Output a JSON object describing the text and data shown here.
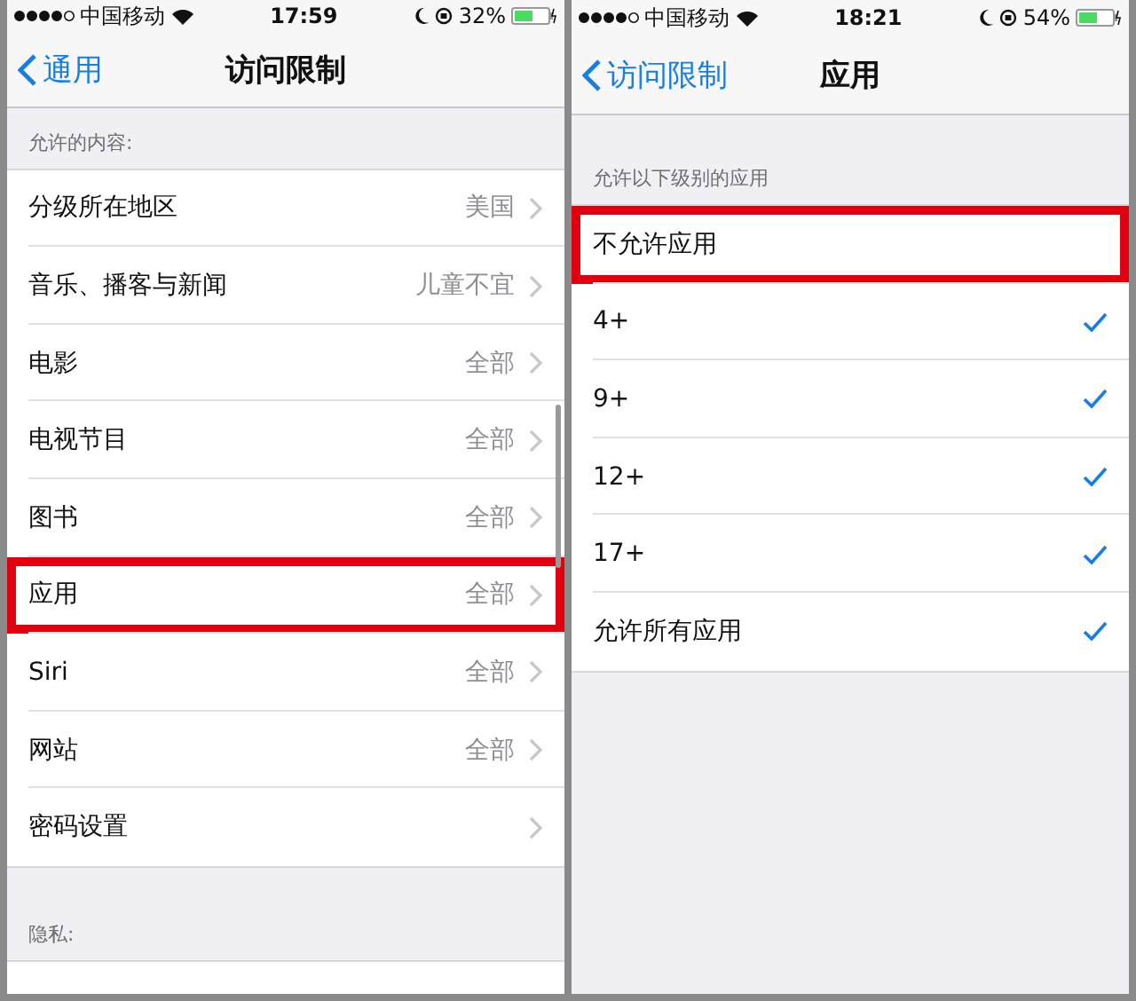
{
  "screens": [
    {
      "status_bar": {
        "carrier": "中国移动",
        "time": "17:59",
        "battery": "32%"
      },
      "nav": {
        "back": "通用",
        "title": "访问限制"
      },
      "sections": [
        {
          "header": "允许的内容:",
          "rows": [
            {
              "kind": "disclosure",
              "label": "分级所在地区",
              "detail": "美国",
              "highlighted": false
            },
            {
              "kind": "disclosure",
              "label": "音乐、播客与新闻",
              "detail": "儿童不宜",
              "highlighted": false
            },
            {
              "kind": "disclosure",
              "label": "电影",
              "detail": "全部",
              "highlighted": false
            },
            {
              "kind": "disclosure",
              "label": "电视节目",
              "detail": "全部",
              "highlighted": false
            },
            {
              "kind": "disclosure",
              "label": "图书",
              "detail": "全部",
              "highlighted": false
            },
            {
              "kind": "disclosure",
              "label": "应用",
              "detail": "全部",
              "highlighted": true
            },
            {
              "kind": "disclosure",
              "label": "Siri",
              "detail": "全部",
              "highlighted": false
            },
            {
              "kind": "disclosure",
              "label": "网站",
              "detail": "全部",
              "highlighted": false
            },
            {
              "kind": "disclosure",
              "label": "密码设置",
              "highlighted": false
            }
          ]
        },
        {
          "header": "隐私:"
        }
      ]
    },
    {
      "status_bar": {
        "carrier": "中国移动",
        "time": "18:21",
        "battery": "54%"
      },
      "nav": {
        "back": "访问限制",
        "title": "应用"
      },
      "sections": [
        {
          "header": "允许以下级别的应用",
          "rows": [
            {
              "kind": "checkmark",
              "label": "不允许应用",
              "checked": false,
              "highlighted": true
            },
            {
              "kind": "checkmark",
              "label": "4+",
              "checked": true,
              "highlighted": false
            },
            {
              "kind": "checkmark",
              "label": "9+",
              "checked": true,
              "highlighted": false
            },
            {
              "kind": "checkmark",
              "label": "12+",
              "checked": true,
              "highlighted": false
            },
            {
              "kind": "checkmark",
              "label": "17+",
              "checked": true,
              "highlighted": false
            },
            {
              "kind": "checkmark",
              "label": "允许所有应用",
              "checked": true,
              "highlighted": false
            }
          ]
        }
      ]
    }
  ]
}
